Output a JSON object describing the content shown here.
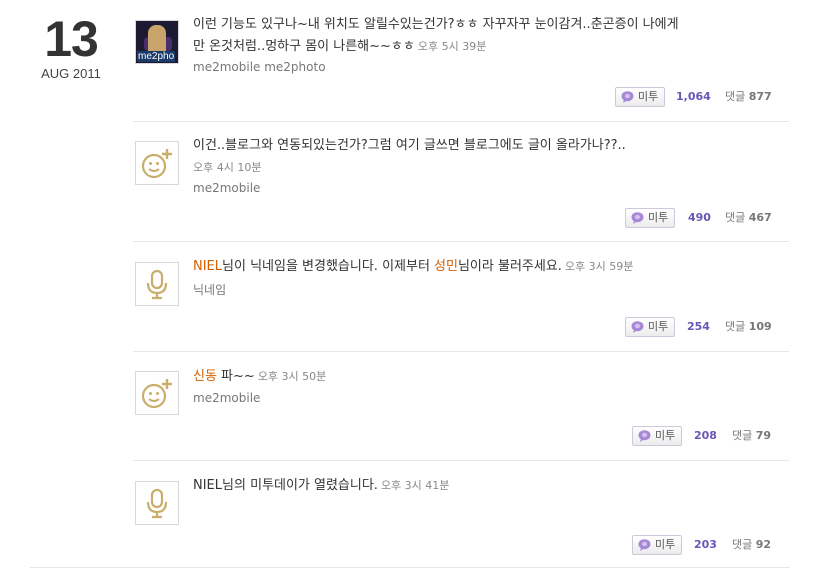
{
  "date": {
    "day": "13",
    "month_year": "AUG 2011"
  },
  "posts": [
    {
      "text_lines": [
        "이런 기능도 있구나~내 위치도 알릴수있는건가?ㅎㅎ 자꾸자꾸 눈이감겨..춘곤증이 나에게",
        "만 온것처럼..멍하구 몸이 나른해~~ㅎㅎ"
      ],
      "time": "오후 5시 39분",
      "tags": "me2mobile me2photo",
      "avatar": {
        "type": "photo",
        "label": "me2pho"
      },
      "metoo_label": "미투",
      "metoo_count": "1,064",
      "comments_label": "댓글",
      "comments_count": "877"
    },
    {
      "text": "이건..블로그와 연동되있는건가?그럼 여기 글쓰면 블로그에도 글이 올라가나??..",
      "time": "오후 4시 10분",
      "tags": "me2mobile",
      "avatar": {
        "type": "smiley-plus-icon"
      },
      "metoo_label": "미투",
      "metoo_count": "490",
      "comments_label": "댓글",
      "comments_count": "467"
    },
    {
      "name1": "NIEL",
      "text_part1": "님이 닉네임을 변경했습니다. 이제부터 ",
      "name2": "성민",
      "text_part2": "님이라 불러주세요.",
      "time": "오후 3시 59분",
      "tags": "닉네임",
      "avatar": {
        "type": "microphone-icon"
      },
      "metoo_label": "미투",
      "metoo_count": "254",
      "comments_label": "댓글",
      "comments_count": "109"
    },
    {
      "name1": "신동",
      "text_part1": " 파~~",
      "time": "오후 3시 50분",
      "tags": "me2mobile",
      "avatar": {
        "type": "smiley-plus-icon"
      },
      "metoo_label": "미투",
      "metoo_count": "208",
      "comments_label": "댓글",
      "comments_count": "79"
    },
    {
      "text": "NIEL님의 미투데이가 열렸습니다.",
      "time": "오후 3시 41분",
      "avatar": {
        "type": "microphone-icon"
      },
      "metoo_label": "미투",
      "metoo_count": "203",
      "comments_label": "댓글",
      "comments_count": "92"
    }
  ],
  "colors": {
    "accent_purple": "#6a56b7",
    "name_orange": "#d45f00",
    "icon_gold": "#c9ad6b"
  }
}
